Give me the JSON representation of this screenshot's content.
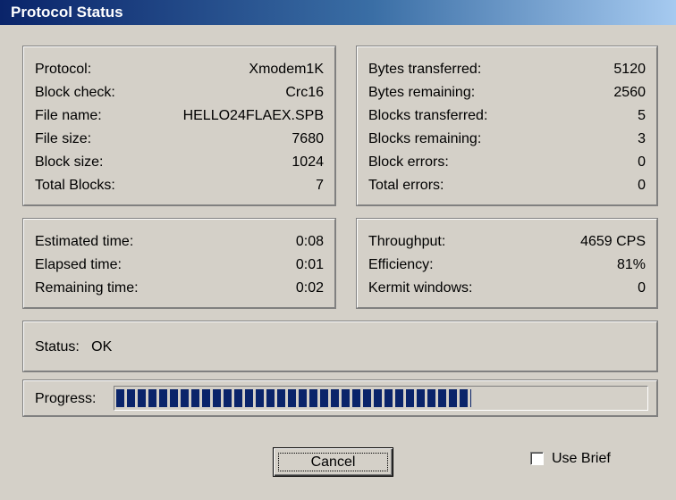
{
  "window": {
    "title": "Protocol Status"
  },
  "file_info": [
    {
      "label": "Protocol:",
      "value": "Xmodem1K"
    },
    {
      "label": "Block check:",
      "value": "Crc16"
    },
    {
      "label": "File name:",
      "value": "HELLO24FLAEX.SPB"
    },
    {
      "label": "File size:",
      "value": "7680"
    },
    {
      "label": "Block size:",
      "value": "1024"
    },
    {
      "label": "Total Blocks:",
      "value": "7"
    }
  ],
  "transfer_info": [
    {
      "label": "Bytes transferred:",
      "value": "5120"
    },
    {
      "label": "Bytes remaining:",
      "value": "2560"
    },
    {
      "label": "Blocks transferred:",
      "value": "5"
    },
    {
      "label": "Blocks remaining:",
      "value": "3"
    },
    {
      "label": "Block errors:",
      "value": "0"
    },
    {
      "label": "Total errors:",
      "value": "0"
    }
  ],
  "time_info": [
    {
      "label": "Estimated time:",
      "value": "0:08"
    },
    {
      "label": "Elapsed time:",
      "value": "0:01"
    },
    {
      "label": "Remaining time:",
      "value": "0:02"
    }
  ],
  "throughput_info": [
    {
      "label": "Throughput:",
      "value": "4659 CPS"
    },
    {
      "label": "Efficiency:",
      "value": "81%"
    },
    {
      "label": "Kermit windows:",
      "value": "0"
    }
  ],
  "status": {
    "text": "Status:   OK"
  },
  "progress": {
    "label": "Progress:",
    "fraction": 0.67
  },
  "buttons": {
    "cancel_label": "Cancel"
  },
  "use_brief": {
    "label": "Use Brief",
    "checked": false
  },
  "colors": {
    "title_start": "#0a246a",
    "title_end": "#a6caf0",
    "progress": "#0a246a",
    "face": "#d4d0c8"
  }
}
